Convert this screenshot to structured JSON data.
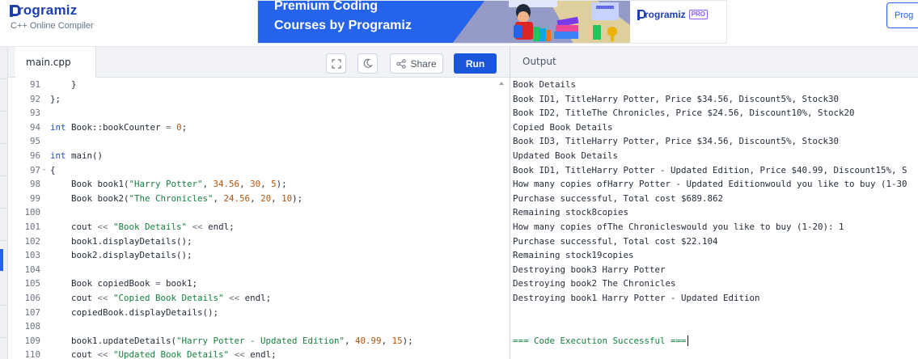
{
  "header": {
    "logo_text": "rogramiz",
    "subtitle": "C++ Online Compiler",
    "banner": {
      "title_line1": "Premium Coding",
      "title_line2": "Courses by Programiz",
      "brand_text": "rogramiz",
      "pro_badge": "PRO"
    },
    "top_button_label": "Prog"
  },
  "editor": {
    "file_tab": "main.cpp",
    "share_label": "Share",
    "run_label": "Run",
    "lines": [
      {
        "num": "91",
        "fold": "",
        "code": "    }"
      },
      {
        "num": "92",
        "fold": "",
        "code": "};"
      },
      {
        "num": "93",
        "fold": "",
        "code": ""
      },
      {
        "num": "94",
        "fold": "",
        "code": "int Book::bookCounter = 0;"
      },
      {
        "num": "95",
        "fold": "",
        "code": ""
      },
      {
        "num": "96",
        "fold": "",
        "code": "int main()"
      },
      {
        "num": "97",
        "fold": "-",
        "code": "{"
      },
      {
        "num": "98",
        "fold": "",
        "code": "    Book book1(\"Harry Potter\", 34.56, 30, 5);"
      },
      {
        "num": "99",
        "fold": "",
        "code": "    Book book2(\"The Chronicles\", 24.56, 20, 10);"
      },
      {
        "num": "100",
        "fold": "",
        "code": ""
      },
      {
        "num": "101",
        "fold": "",
        "code": "    cout << \"Book Details\" << endl;"
      },
      {
        "num": "102",
        "fold": "",
        "code": "    book1.displayDetails();"
      },
      {
        "num": "103",
        "fold": "",
        "code": "    book2.displayDetails();"
      },
      {
        "num": "104",
        "fold": "",
        "code": ""
      },
      {
        "num": "105",
        "fold": "",
        "code": "    Book copiedBook = book1;"
      },
      {
        "num": "106",
        "fold": "",
        "code": "    cout << \"Copied Book Details\" << endl;"
      },
      {
        "num": "107",
        "fold": "",
        "code": "    copiedBook.displayDetails();"
      },
      {
        "num": "108",
        "fold": "",
        "code": ""
      },
      {
        "num": "109",
        "fold": "",
        "code": "    book1.updateDetails(\"Harry Potter - Updated Edition\", 40.99, 15);"
      },
      {
        "num": "110",
        "fold": "",
        "code": "    cout << \"Updated Book Details\" << endl;"
      }
    ]
  },
  "output": {
    "title": "Output",
    "lines": [
      "Book Details",
      "Book ID1, TitleHarry Potter, Price $34.56, Discount5%, Stock30",
      "Book ID2, TitleThe Chronicles, Price $24.56, Discount10%, Stock20",
      "Copied Book Details",
      "Book ID3, TitleHarry Potter, Price $34.56, Discount5%, Stock30",
      "Updated Book Details",
      "Book ID1, TitleHarry Potter - Updated Edition, Price $40.99, Discount15%, S",
      "How many copies ofHarry Potter - Updated Editionwould you like to buy (1-30",
      "Purchase successful, Total cost $689.862",
      "Remaining stock8copies",
      "How many copies ofThe Chronicleswould you like to buy (1-20): 1",
      "Purchase successful, Total cost $22.104",
      "Remaining stock19copies",
      "Destroying book3 Harry Potter",
      "Destroying book2 The Chronicles",
      "Destroying book1 Harry Potter - Updated Edition",
      "",
      "",
      "=== Code Execution Successful ==="
    ]
  },
  "colors": {
    "brand": "#1e40af",
    "run_button": "#1a56db",
    "success": "#15803d",
    "keyword": "#1d4ed8",
    "string": "#15803d",
    "number": "#b45309"
  },
  "icons": [
    "fullscreen-icon",
    "moon-icon",
    "share-icon"
  ]
}
